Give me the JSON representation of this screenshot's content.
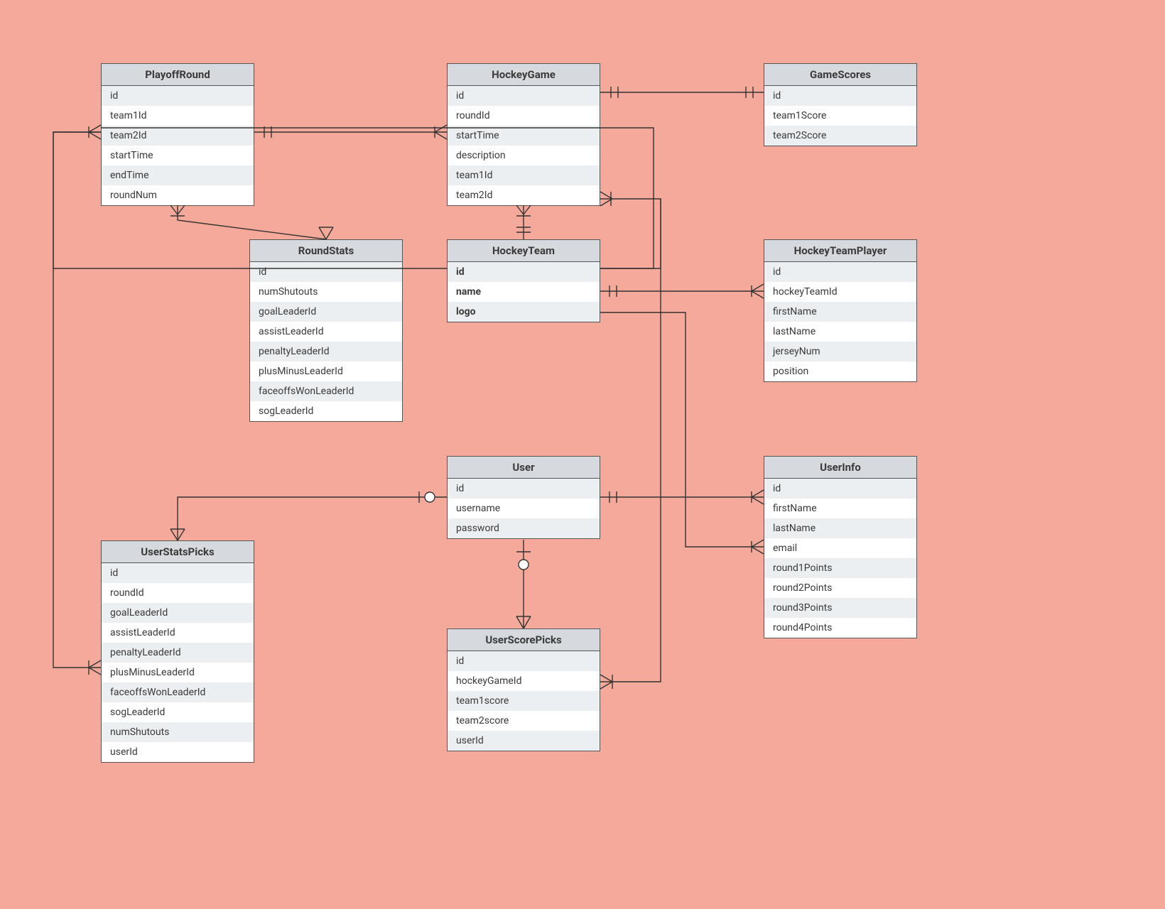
{
  "entities": {
    "playoffRound": {
      "title": "PlayoffRound",
      "fields": [
        "id",
        "team1Id",
        "team2Id",
        "startTime",
        "endTime",
        "roundNum"
      ]
    },
    "hockeyGame": {
      "title": "HockeyGame",
      "fields": [
        "id",
        "roundId",
        "startTime",
        "description",
        "team1Id",
        "team2Id"
      ]
    },
    "gameScores": {
      "title": "GameScores",
      "fields": [
        "id",
        "team1Score",
        "team2Score"
      ]
    },
    "roundStats": {
      "title": "RoundStats",
      "fields": [
        "id",
        "numShutouts",
        "goalLeaderId",
        "assistLeaderId",
        "penaltyLeaderId",
        "plusMinusLeaderId",
        "faceoffsWonLeaderId",
        "sogLeaderId"
      ]
    },
    "hockeyTeam": {
      "title": "HockeyTeam",
      "fields": [
        "id",
        "name",
        "logo"
      ]
    },
    "hockeyTeamPlayer": {
      "title": "HockeyTeamPlayer",
      "fields": [
        "id",
        "hockeyTeamId",
        "firstName",
        "lastName",
        "jerseyNum",
        "position"
      ]
    },
    "user": {
      "title": "User",
      "fields": [
        "id",
        "username",
        "password"
      ]
    },
    "userInfo": {
      "title": "UserInfo",
      "fields": [
        "id",
        "firstName",
        "lastName",
        "email",
        "round1Points",
        "round2Points",
        "round3Points",
        "round4Points"
      ]
    },
    "userStatsPicks": {
      "title": "UserStatsPicks",
      "fields": [
        "id",
        "roundId",
        "goalLeaderId",
        "assistLeaderId",
        "penaltyLeaderId",
        "plusMinusLeaderId",
        "faceoffsWonLeaderId",
        "sogLeaderId",
        "numShutouts",
        "userId"
      ]
    },
    "userScorePicks": {
      "title": "UserScorePicks",
      "fields": [
        "id",
        "hockeyGameId",
        "team1score",
        "team2score",
        "userId"
      ]
    }
  },
  "chart_data": {
    "type": "er-diagram",
    "entities": [
      {
        "name": "PlayoffRound",
        "attributes": [
          "id",
          "team1Id",
          "team2Id",
          "startTime",
          "endTime",
          "roundNum"
        ]
      },
      {
        "name": "HockeyGame",
        "attributes": [
          "id",
          "roundId",
          "startTime",
          "description",
          "team1Id",
          "team2Id"
        ]
      },
      {
        "name": "GameScores",
        "attributes": [
          "id",
          "team1Score",
          "team2Score"
        ]
      },
      {
        "name": "RoundStats",
        "attributes": [
          "id",
          "numShutouts",
          "goalLeaderId",
          "assistLeaderId",
          "penaltyLeaderId",
          "plusMinusLeaderId",
          "faceoffsWonLeaderId",
          "sogLeaderId"
        ]
      },
      {
        "name": "HockeyTeam",
        "attributes": [
          "id",
          "name",
          "logo"
        ],
        "bold": true
      },
      {
        "name": "HockeyTeamPlayer",
        "attributes": [
          "id",
          "hockeyTeamId",
          "firstName",
          "lastName",
          "jerseyNum",
          "position"
        ]
      },
      {
        "name": "User",
        "attributes": [
          "id",
          "username",
          "password"
        ]
      },
      {
        "name": "UserInfo",
        "attributes": [
          "id",
          "firstName",
          "lastName",
          "email",
          "round1Points",
          "round2Points",
          "round3Points",
          "round4Points"
        ]
      },
      {
        "name": "UserStatsPicks",
        "attributes": [
          "id",
          "roundId",
          "goalLeaderId",
          "assistLeaderId",
          "penaltyLeaderId",
          "plusMinusLeaderId",
          "faceoffsWonLeaderId",
          "sogLeaderId",
          "numShutouts",
          "userId"
        ]
      },
      {
        "name": "UserScorePicks",
        "attributes": [
          "id",
          "hockeyGameId",
          "team1score",
          "team2score",
          "userId"
        ]
      }
    ],
    "relationships": [
      {
        "from": "PlayoffRound",
        "to": "HockeyGame",
        "type": "one-to-many"
      },
      {
        "from": "HockeyGame",
        "to": "GameScores",
        "type": "one-to-one"
      },
      {
        "from": "PlayoffRound",
        "to": "RoundStats",
        "type": "one-to-many"
      },
      {
        "from": "HockeyTeam",
        "to": "HockeyGame",
        "type": "one-to-many"
      },
      {
        "from": "HockeyTeam",
        "to": "HockeyTeamPlayer",
        "type": "one-to-many"
      },
      {
        "from": "HockeyTeam",
        "to": "PlayoffRound",
        "type": "one-to-many"
      },
      {
        "from": "User",
        "to": "UserInfo",
        "type": "one-to-many"
      },
      {
        "from": "User",
        "to": "UserScorePicks",
        "type": "one-to-many"
      },
      {
        "from": "User",
        "to": "UserStatsPicks",
        "type": "one-to-many"
      },
      {
        "from": "UserScorePicks",
        "to": "HockeyGame",
        "type": "many-to-one"
      },
      {
        "from": "UserStatsPicks",
        "to": "PlayoffRound",
        "type": "many-to-one"
      }
    ]
  }
}
